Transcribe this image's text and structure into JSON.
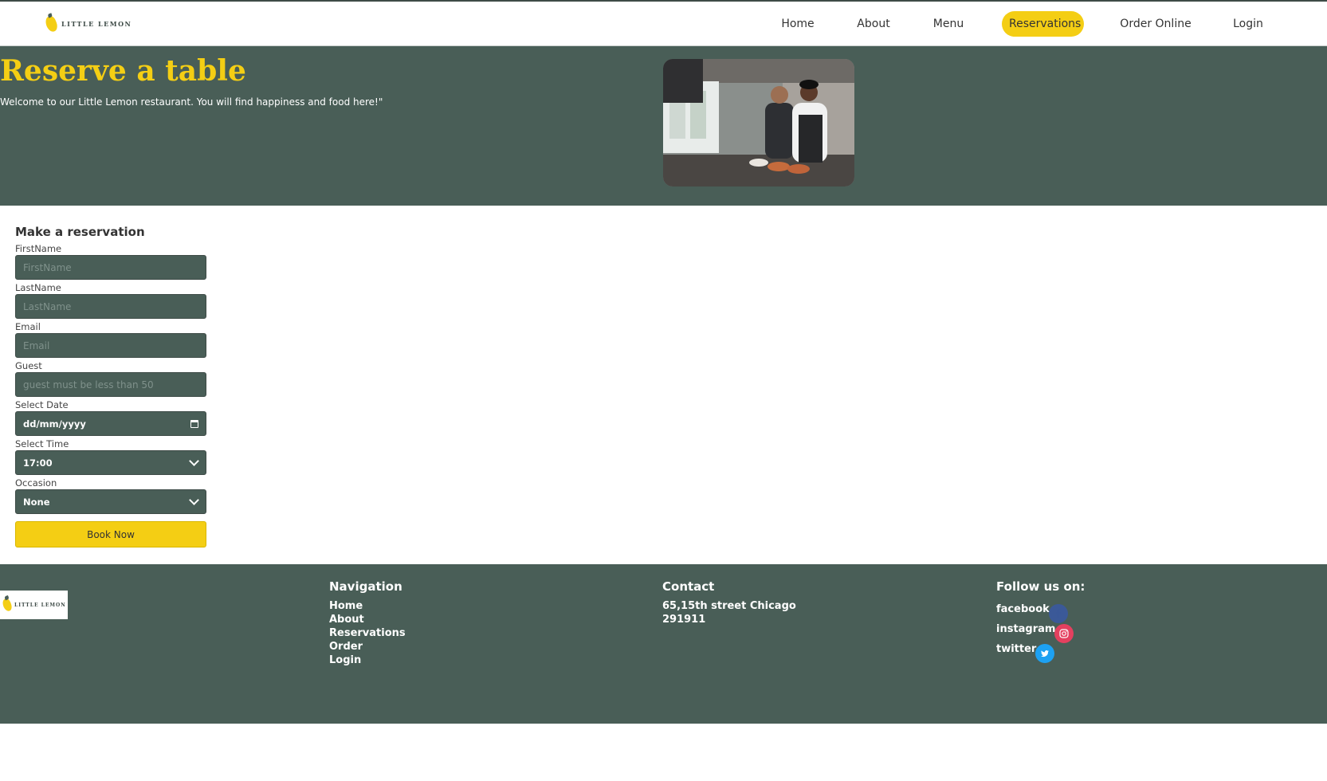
{
  "brand": {
    "name": "Little Lemon"
  },
  "nav": {
    "items": [
      {
        "label": "Home"
      },
      {
        "label": "About"
      },
      {
        "label": "Menu"
      },
      {
        "label": "Reservations"
      },
      {
        "label": "Order Online"
      },
      {
        "label": "Login"
      }
    ],
    "active": "Reservations"
  },
  "hero": {
    "title": "Reserve a table",
    "subtitle": "Welcome to our Little Lemon restaurant. You will find happiness and food here!\""
  },
  "form": {
    "title": "Make a reservation",
    "firstname": {
      "label": "FirstName",
      "placeholder": "FirstName"
    },
    "lastname": {
      "label": "LastName",
      "placeholder": "LastName"
    },
    "email": {
      "label": "Email",
      "placeholder": "Email"
    },
    "guest": {
      "label": "Guest",
      "placeholder": "guest must be less than 50"
    },
    "date": {
      "label": "Select Date",
      "value": "dd/mm/yyyy"
    },
    "time": {
      "label": "Select Time",
      "value": "17:00"
    },
    "occasion": {
      "label": "Occasion",
      "value": "None"
    },
    "submit_label": "Book Now"
  },
  "footer": {
    "navigation": {
      "title": "Navigation",
      "links": [
        "Home",
        "About",
        "Reservations",
        "Order",
        "Login"
      ]
    },
    "contact": {
      "title": "Contact",
      "lines": [
        "65,15th street Chicago",
        "291911"
      ]
    },
    "social": {
      "title": "Follow us on:",
      "items": [
        {
          "label": "facebook",
          "icon": "facebook-icon",
          "color": "#3b5998"
        },
        {
          "label": "instagram",
          "icon": "instagram-icon",
          "color": "#e4405f"
        },
        {
          "label": "twitter",
          "icon": "twitter-icon",
          "color": "#1da1f2"
        }
      ]
    }
  },
  "colors": {
    "primary": "#495e57",
    "accent": "#f4ce14",
    "text": "#333333"
  }
}
